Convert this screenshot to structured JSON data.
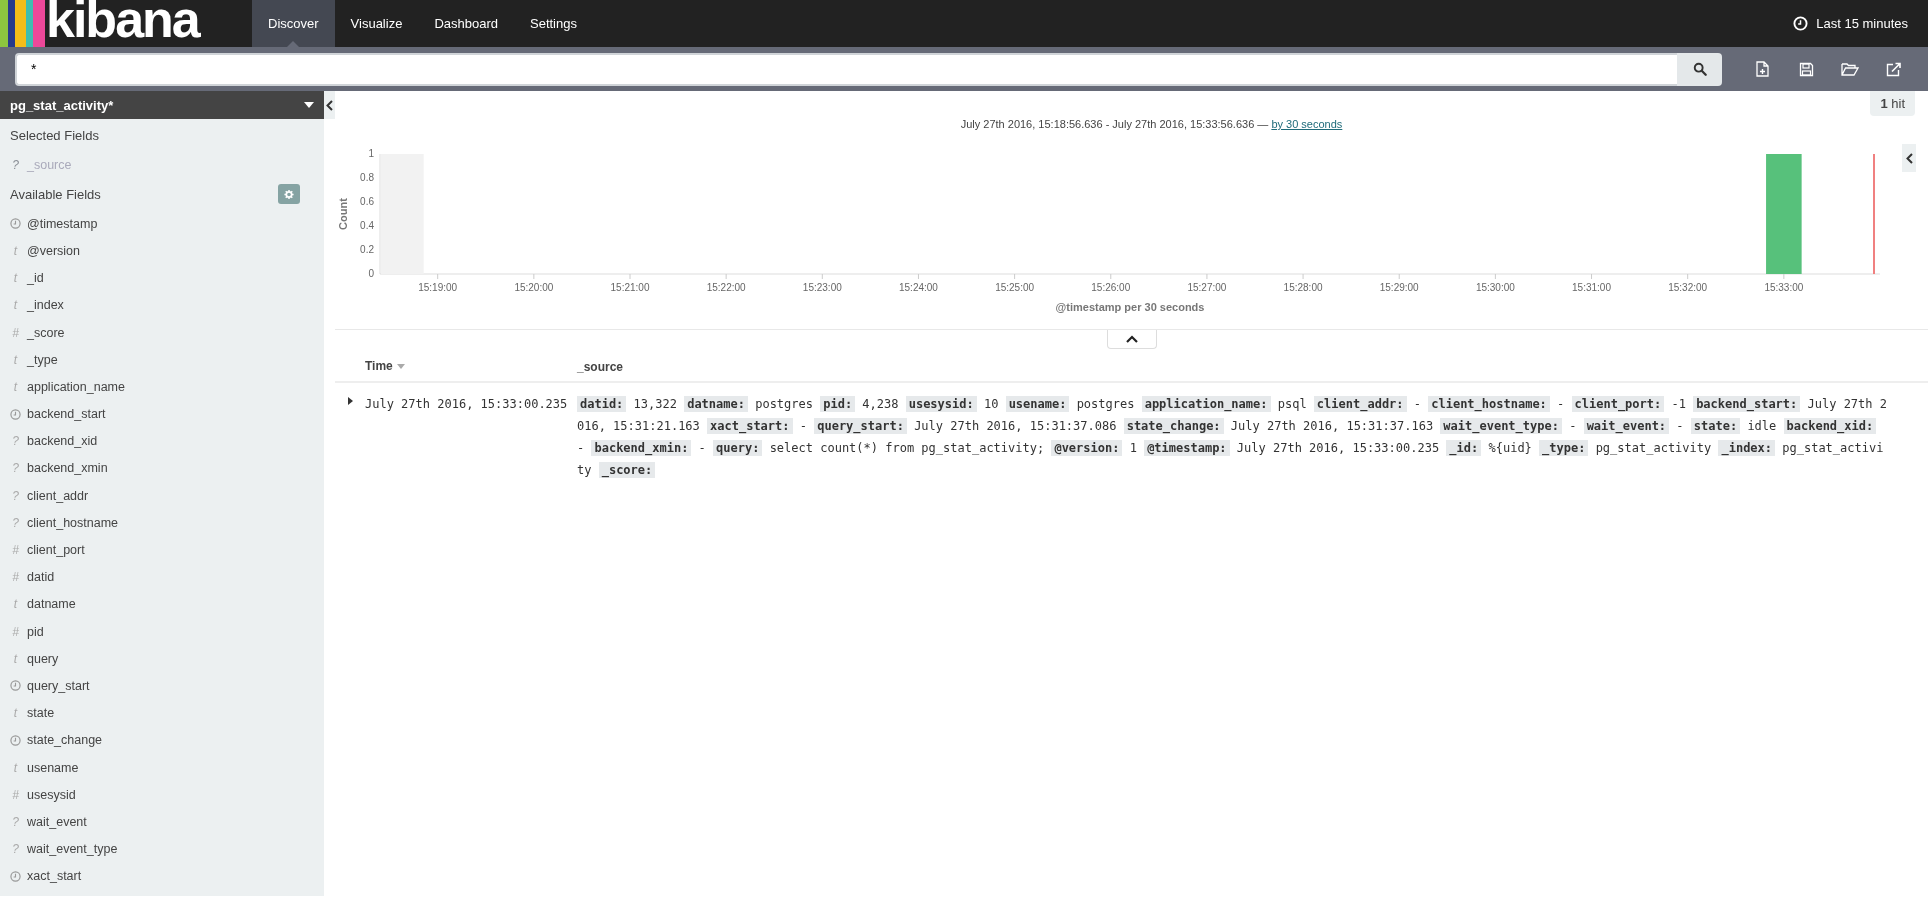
{
  "nav": {
    "logo": "kibana",
    "tabs": [
      {
        "label": "Discover",
        "selected": true
      },
      {
        "label": "Visualize",
        "selected": false
      },
      {
        "label": "Dashboard",
        "selected": false
      },
      {
        "label": "Settings",
        "selected": false
      }
    ],
    "time_picker": "Last 15 minutes"
  },
  "search": {
    "value": "*"
  },
  "sidebar": {
    "index_pattern": "pg_stat_activity*",
    "selected_title": "Selected Fields",
    "selected_fields": [
      {
        "name": "_source",
        "kind": "unknown",
        "glyph": "?"
      }
    ],
    "available_title": "Available Fields",
    "available_fields": [
      {
        "name": "@timestamp",
        "kind": "date"
      },
      {
        "name": "@version",
        "kind": "string",
        "glyph": "t"
      },
      {
        "name": "_id",
        "kind": "string",
        "glyph": "t"
      },
      {
        "name": "_index",
        "kind": "string",
        "glyph": "t"
      },
      {
        "name": "_score",
        "kind": "number",
        "glyph": "#"
      },
      {
        "name": "_type",
        "kind": "string",
        "glyph": "t"
      },
      {
        "name": "application_name",
        "kind": "string",
        "glyph": "t"
      },
      {
        "name": "backend_start",
        "kind": "date"
      },
      {
        "name": "backend_xid",
        "kind": "unknown",
        "glyph": "?"
      },
      {
        "name": "backend_xmin",
        "kind": "unknown",
        "glyph": "?"
      },
      {
        "name": "client_addr",
        "kind": "unknown",
        "glyph": "?"
      },
      {
        "name": "client_hostname",
        "kind": "unknown",
        "glyph": "?"
      },
      {
        "name": "client_port",
        "kind": "number",
        "glyph": "#"
      },
      {
        "name": "datid",
        "kind": "number",
        "glyph": "#"
      },
      {
        "name": "datname",
        "kind": "string",
        "glyph": "t"
      },
      {
        "name": "pid",
        "kind": "number",
        "glyph": "#"
      },
      {
        "name": "query",
        "kind": "string",
        "glyph": "t"
      },
      {
        "name": "query_start",
        "kind": "date"
      },
      {
        "name": "state",
        "kind": "string",
        "glyph": "t"
      },
      {
        "name": "state_change",
        "kind": "date"
      },
      {
        "name": "usename",
        "kind": "string",
        "glyph": "t"
      },
      {
        "name": "usesysid",
        "kind": "number",
        "glyph": "#"
      },
      {
        "name": "wait_event",
        "kind": "unknown",
        "glyph": "?"
      },
      {
        "name": "wait_event_type",
        "kind": "unknown",
        "glyph": "?"
      },
      {
        "name": "xact_start",
        "kind": "date"
      }
    ]
  },
  "hits": "**1** hit",
  "histogram": {
    "range": "July 27th 2016, 15:18:56.636 - July 27th 2016, 15:33:56.636 —",
    "interval_link": "by 30 seconds",
    "chart_data": {
      "type": "bar",
      "xlabel": "@timestamp per 30 seconds",
      "ylabel": "Count",
      "categories": [
        "15:19:00",
        "15:20:00",
        "15:21:00",
        "15:22:00",
        "15:23:00",
        "15:24:00",
        "15:25:00",
        "15:26:00",
        "15:27:00",
        "15:28:00",
        "15:29:00",
        "15:30:00",
        "15:31:00",
        "15:32:00",
        "15:33:00"
      ],
      "values": [
        0,
        0,
        0,
        0,
        0,
        0,
        0,
        0,
        0,
        0,
        0,
        0,
        0,
        0,
        1
      ],
      "ylim": [
        0,
        1
      ],
      "yticks": [
        0,
        0.2,
        0.4,
        0.6,
        0.8,
        1
      ]
    }
  },
  "table": {
    "columns": [
      "Time",
      "_source"
    ],
    "rows": [
      {
        "expanded": false,
        "time": "July 27th 2016, 15:33:00.235",
        "source": [
          {
            "key": "datid:",
            "value": "13,322"
          },
          {
            "key": "datname:",
            "value": "postgres"
          },
          {
            "key": "pid:",
            "value": "4,238"
          },
          {
            "key": "usesysid:",
            "value": "10"
          },
          {
            "key": "usename:",
            "value": "postgres"
          },
          {
            "key": "application_name:",
            "value": "psql"
          },
          {
            "key": "client_addr:",
            "value": " - "
          },
          {
            "key": "client_hostname:",
            "value": " - "
          },
          {
            "key": "client_port:",
            "value": "-1"
          },
          {
            "key": "backend_start:",
            "value": "July 27th 2016, 15:31:21.163"
          },
          {
            "key": "xact_start:",
            "value": "-"
          },
          {
            "key": "query_start:",
            "value": "July 27th 2016, 15:31:37.086"
          },
          {
            "key": "state_change:",
            "value": "July 27th 2016, 15:31:37.163"
          },
          {
            "key": "wait_event_type:",
            "value": " - "
          },
          {
            "key": "wait_event:",
            "value": " - "
          },
          {
            "key": "state:",
            "value": "idle"
          },
          {
            "key": "backend_xid:",
            "value": " - "
          },
          {
            "key": "backend_xmin:",
            "value": " - "
          },
          {
            "key": "query:",
            "value": "select count(*) from pg_stat_activity;"
          },
          {
            "key": "@version:",
            "value": "1"
          },
          {
            "key": "@timestamp:",
            "value": "July 27th 2016, 15:33:00.235"
          },
          {
            "key": "_id:",
            "value": "%{uid}"
          },
          {
            "key": "_type:",
            "value": "pg_stat_activity"
          },
          {
            "key": "_index:",
            "value": "pg_stat_activity"
          },
          {
            "key": "_score:"
          }
        ]
      }
    ]
  }
}
